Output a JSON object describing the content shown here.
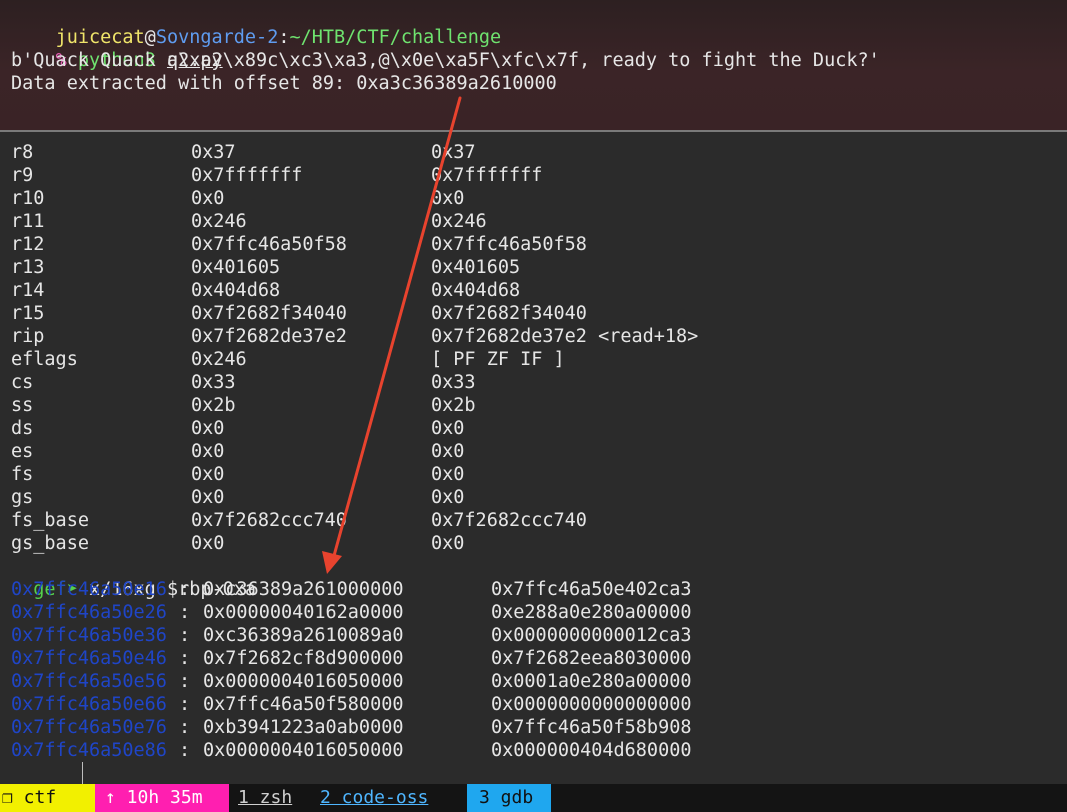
{
  "shell": {
    "user": "juicecat",
    "at": "@",
    "host": "Sovngarde-2",
    "sep": ":",
    "path": "~/HTB/CTF/challenge",
    "prompt_char": "%",
    "command": "python3",
    "argument": "q2.py",
    "output_line1": "b'Quack Quack a\\xa2\\x89c\\xc3\\xa3,@\\x0e\\xa5F\\xfc\\x7f, ready to fight the Duck?'",
    "output_line2": "Data extracted with offset 89: 0xa3c36389a2610000"
  },
  "registers": [
    {
      "name": "r8",
      "hex": "0x37",
      "value": "0x37"
    },
    {
      "name": "r9",
      "hex": "0x7fffffff",
      "value": "0x7fffffff"
    },
    {
      "name": "r10",
      "hex": "0x0",
      "value": "0x0"
    },
    {
      "name": "r11",
      "hex": "0x246",
      "value": "0x246"
    },
    {
      "name": "r12",
      "hex": "0x7ffc46a50f58",
      "value": "0x7ffc46a50f58"
    },
    {
      "name": "r13",
      "hex": "0x401605",
      "value": "0x401605"
    },
    {
      "name": "r14",
      "hex": "0x404d68",
      "value": "0x404d68"
    },
    {
      "name": "r15",
      "hex": "0x7f2682f34040",
      "value": "0x7f2682f34040"
    },
    {
      "name": "rip",
      "hex": "0x7f2682de37e2",
      "value": "0x7f2682de37e2 <read+18>"
    },
    {
      "name": "eflags",
      "hex": "0x246",
      "value": "[ PF ZF IF ]"
    },
    {
      "name": "cs",
      "hex": "0x33",
      "value": "0x33"
    },
    {
      "name": "ss",
      "hex": "0x2b",
      "value": "0x2b"
    },
    {
      "name": "ds",
      "hex": "0x0",
      "value": "0x0"
    },
    {
      "name": "es",
      "hex": "0x0",
      "value": "0x0"
    },
    {
      "name": "fs",
      "hex": "0x0",
      "value": "0x0"
    },
    {
      "name": "gs",
      "hex": "0x0",
      "value": "0x0"
    },
    {
      "name": "fs_base",
      "hex": "0x7f2682ccc740",
      "value": "0x7f2682ccc740"
    },
    {
      "name": "gs_base",
      "hex": "0x0",
      "value": "0x0"
    }
  ],
  "gef": {
    "prompt": "gef➤",
    "command": "x/16xg $rbp-0xa"
  },
  "memory": [
    {
      "addr": "0x7ffc46a50e16",
      "v1": "0xc36389a261000000",
      "v2": "0x7ffc46a50e402ca3"
    },
    {
      "addr": "0x7ffc46a50e26",
      "v1": "0x00000040162a0000",
      "v2": "0xe288a0e280a00000"
    },
    {
      "addr": "0x7ffc46a50e36",
      "v1": "0xc36389a2610089a0",
      "v2": "0x0000000000012ca3"
    },
    {
      "addr": "0x7ffc46a50e46",
      "v1": "0x7f2682cf8d900000",
      "v2": "0x7f2682eea8030000"
    },
    {
      "addr": "0x7ffc46a50e56",
      "v1": "0x0000004016050000",
      "v2": "0x0001a0e280a00000"
    },
    {
      "addr": "0x7ffc46a50e66",
      "v1": "0x7ffc46a50f580000",
      "v2": "0x0000000000000000"
    },
    {
      "addr": "0x7ffc46a50e76",
      "v1": "0xb3941223a0ab0000",
      "v2": "0x7ffc46a50f58b908"
    },
    {
      "addr": "0x7ffc46a50e86",
      "v1": "0x0000004016050000",
      "v2": "0x000000404d680000"
    }
  ],
  "statusbar": {
    "session": "❐ ctf",
    "uptime": "↑ 10h 35m",
    "win1": "1 zsh",
    "win2": "2 code-oss",
    "win3": "3 gdb"
  },
  "colors": {
    "arrow": "#e8432e",
    "address": "#1f45c7",
    "gef_prompt": "#55d04c"
  }
}
